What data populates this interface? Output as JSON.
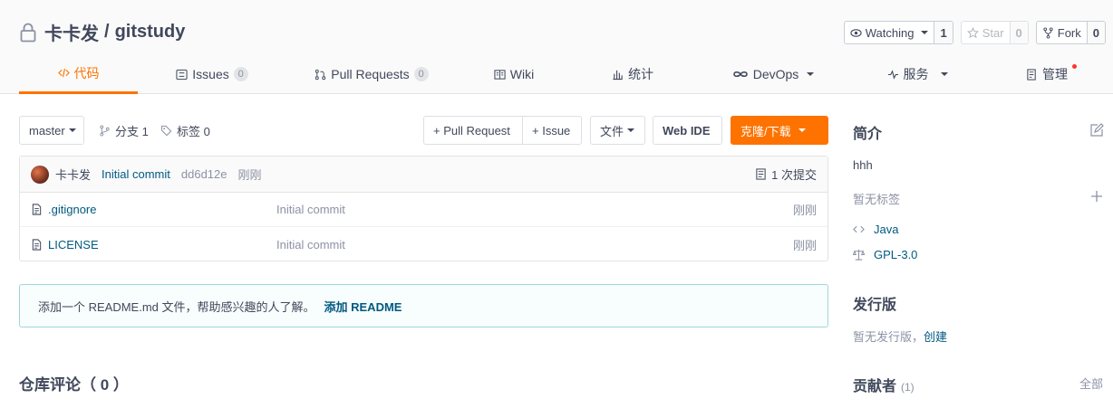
{
  "repo": {
    "owner": "卡卡发",
    "separator": "/",
    "name": "gitstudy"
  },
  "actions": {
    "watch": {
      "label": "Watching",
      "count": "1"
    },
    "star": {
      "label": "Star",
      "count": "0"
    },
    "fork": {
      "label": "Fork",
      "count": "0"
    }
  },
  "tabs": [
    {
      "label": "代码",
      "icon": "code-icon",
      "active": true
    },
    {
      "label": "Issues",
      "icon": "issues-icon",
      "badge": "0"
    },
    {
      "label": "Pull Requests",
      "icon": "pull-request-icon",
      "badge": "0"
    },
    {
      "label": "Wiki",
      "icon": "wiki-icon"
    },
    {
      "label": "统计",
      "icon": "stats-icon"
    },
    {
      "label": "DevOps",
      "icon": "devops-icon"
    },
    {
      "label": "服务",
      "icon": "service-icon"
    },
    {
      "label": "管理",
      "icon": "manage-icon"
    }
  ],
  "toolbar": {
    "branch": "master",
    "branches": "分支 1",
    "tags": "标签 0",
    "pull_request": "+ Pull Request",
    "issue": "+ Issue",
    "file": "文件",
    "web_ide": "Web IDE",
    "clone": "克隆/下载"
  },
  "commit": {
    "author": "卡卡发",
    "message": "Initial commit",
    "hash": "dd6d12e",
    "time": "刚刚",
    "count": "1 次提交"
  },
  "files": [
    {
      "name": ".gitignore",
      "message": "Initial commit",
      "time": "刚刚"
    },
    {
      "name": "LICENSE",
      "message": "Initial commit",
      "time": "刚刚"
    }
  ],
  "readme_tip": {
    "text": "添加一个 README.md 文件，帮助感兴趣的人了解。",
    "action": "添加 README"
  },
  "comments": {
    "title": "仓库评论（ 0 ）"
  },
  "sidebar": {
    "intro_title": "简介",
    "description": "hhh",
    "no_tags": "暂无标签",
    "language": "Java",
    "license": "GPL-3.0",
    "release_title": "发行版",
    "no_release": "暂无发行版，",
    "create": "创建",
    "contributors_title": "贡献者",
    "contributors_count": "(1)",
    "all": "全部"
  },
  "colors": {
    "accent": "#fe7300",
    "link": "#005980",
    "tip_border": "#9fd7da"
  }
}
